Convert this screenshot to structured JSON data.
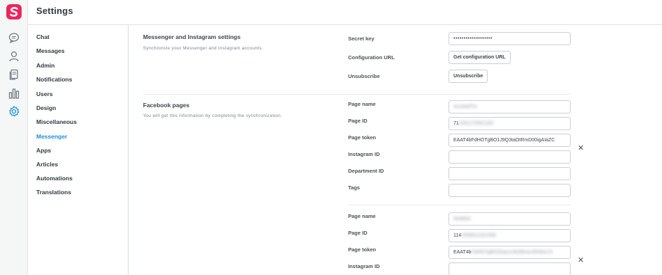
{
  "header": {
    "title": "Settings"
  },
  "rail": {
    "icons": [
      "logo-icon",
      "chat-bubble-icon",
      "user-icon",
      "documents-icon",
      "bar-chart-icon",
      "gear-icon"
    ]
  },
  "nav": {
    "items": [
      {
        "label": "Chat"
      },
      {
        "label": "Messages"
      },
      {
        "label": "Admin"
      },
      {
        "label": "Notifications"
      },
      {
        "label": "Users"
      },
      {
        "label": "Design"
      },
      {
        "label": "Miscellaneous"
      },
      {
        "label": "Messenger"
      },
      {
        "label": "Apps"
      },
      {
        "label": "Articles"
      },
      {
        "label": "Automations"
      },
      {
        "label": "Translations"
      }
    ],
    "active": "Messenger"
  },
  "messenger_section": {
    "title": "Messenger and Instagram settings",
    "description": "Synchronize your Messenger and Instagram accounts.",
    "secret_key_label": "Secret key",
    "secret_key_value": "•••••••••••••••••••",
    "config_url_label": "Configuration URL",
    "config_url_button": "Get configuration URL",
    "unsubscribe_label": "Unsubscribe",
    "unsubscribe_button": "Unsubscribe"
  },
  "facebook_section": {
    "title": "Facebook pages",
    "description": "You will get this information by completing the synchronization.",
    "labels": {
      "page_name": "Page name",
      "page_id": "Page ID",
      "page_token": "Page token",
      "instagram_id": "Instagram ID",
      "department_id": "Department ID",
      "tags": "Tags"
    },
    "pages": [
      {
        "page_name": "AuxiliarPro",
        "page_id_visible": "71",
        "page_id_hidden": "2351170551332",
        "page_token_visible": "EAAT4bFdHOTgBO1J9Q3taOtRmD00igAIaZC",
        "page_token_hidden": "",
        "instagram_id": "",
        "department_id": "",
        "tags": ""
      },
      {
        "page_name": "Multibid",
        "page_id_visible": "114",
        "page_id_hidden": "0559011322455",
        "page_token_visible": "EAAT4b",
        "page_token_hidden": "FdHOTgBO2Dqv1cfk2BexeJ6HtHu7k",
        "instagram_id": ""
      }
    ],
    "remove_symbol": "✕"
  }
}
